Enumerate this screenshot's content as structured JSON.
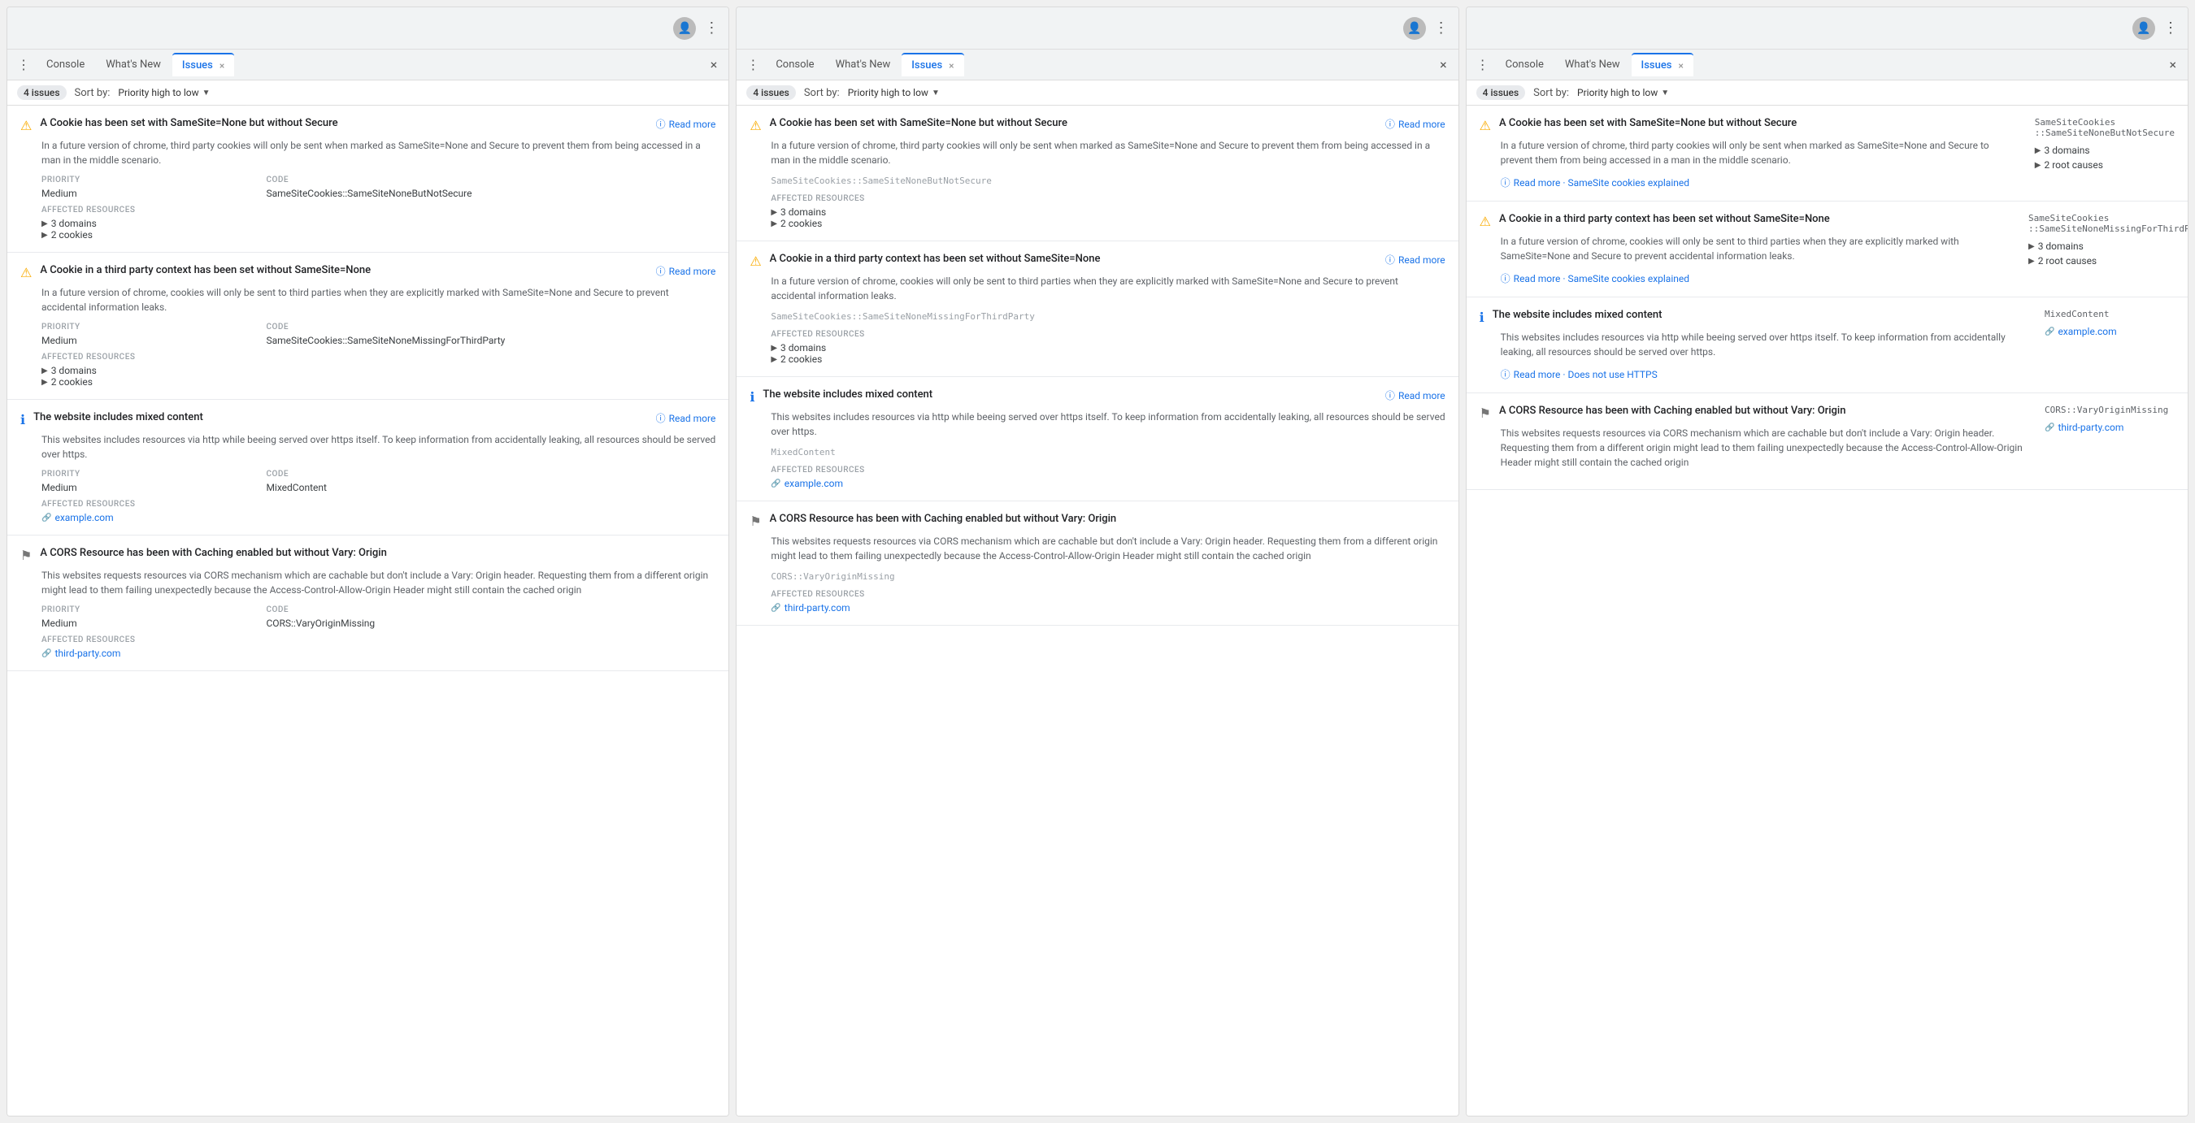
{
  "colors": {
    "accent": "#1a73e8",
    "warning": "#f9ab00",
    "info": "#1a73e8",
    "text_primary": "#202124",
    "text_secondary": "#5f6368",
    "text_muted": "#9aa0a6",
    "border": "#e8eaed"
  },
  "panels": [
    {
      "id": "panel1",
      "tabs": [
        {
          "label": "Console",
          "active": false,
          "closeable": false
        },
        {
          "label": "What's New",
          "active": false,
          "closeable": false
        },
        {
          "label": "Issues",
          "active": true,
          "closeable": true
        }
      ],
      "toolbar": {
        "issues_count": "4 issues",
        "sort_label": "Sort by:",
        "sort_value": "Priority high to low"
      },
      "issues": [
        {
          "type": "warning",
          "title": "A Cookie has been set with SameSite=None but without Secure",
          "read_more": "Read more",
          "description": "In a future version of chrome, third party cookies will only be sent when marked as SameSite=None and Secure to prevent them from being accessed in a man in the middle scenario.",
          "priority_label": "PRIORITY",
          "priority_value": "Medium",
          "code_label": "CODE",
          "code_value": "SameSiteCookies::SameSiteNoneButNotSecure",
          "affected_label": "AFFECTED RESOURCES",
          "resources": [
            {
              "type": "expand",
              "label": "3 domains"
            },
            {
              "type": "expand",
              "label": "2 cookies"
            }
          ]
        },
        {
          "type": "warning",
          "title": "A Cookie in a third party context has been set without SameSite=None",
          "read_more": "Read more",
          "description": "In a future version of chrome, cookies will only be sent to third parties when they are explicitly marked with SameSite=None and Secure to prevent accidental information leaks.",
          "priority_label": "PRIORITY",
          "priority_value": "Medium",
          "code_label": "CODE",
          "code_value": "SameSiteCookies::SameSiteNoneMissingForThirdParty",
          "affected_label": "AFFECTED RESOURCES",
          "resources": [
            {
              "type": "expand",
              "label": "3 domains"
            },
            {
              "type": "expand",
              "label": "2 cookies"
            }
          ]
        },
        {
          "type": "info",
          "title": "The website includes mixed content",
          "read_more": "Read more",
          "description": "This websites includes resources via http while beeing served over https itself. To keep information from accidentally leaking, all resources should be served over https.",
          "priority_label": "PRIORITY",
          "priority_value": "Medium",
          "code_label": "CODE",
          "code_value": "MixedContent",
          "affected_label": "AFFECTED RESOURCES",
          "resources": [
            {
              "type": "link",
              "label": "example.com"
            }
          ]
        },
        {
          "type": "flag",
          "title": "A CORS Resource has been with Caching enabled but without Vary: Origin",
          "read_more": null,
          "description": "This websites requests resources via CORS mechanism which are cachable but don't include a Vary: Origin header. Requesting them from a different origin might lead to them failing unexpectedly because the Access-Control-Allow-Origin Header might still contain the cached origin",
          "priority_label": "PRIORITY",
          "priority_value": "Medium",
          "code_label": "CODE",
          "code_value": "CORS::VaryOriginMissing",
          "affected_label": "AFFECTED RESOURCES",
          "resources": [
            {
              "type": "link",
              "label": "third-party.com"
            }
          ]
        }
      ]
    },
    {
      "id": "panel2",
      "tabs": [
        {
          "label": "Console",
          "active": false,
          "closeable": false
        },
        {
          "label": "What's New",
          "active": false,
          "closeable": false
        },
        {
          "label": "Issues",
          "active": true,
          "closeable": true
        }
      ],
      "toolbar": {
        "issues_count": "4 issues",
        "sort_label": "Sort by:",
        "sort_value": "Priority high to low"
      },
      "issues": [
        {
          "type": "warning",
          "title": "A Cookie has been set with SameSite=None but without Secure",
          "read_more": "Read more",
          "description": "In a future version of chrome, third party cookies will only be sent when marked as SameSite=None and Secure to prevent them from being accessed in a man in the middle scenario.",
          "code_small": "SameSiteCookies::SameSiteNoneButNotSecure",
          "affected_label": "AFFECTED RESOURCES",
          "resources": [
            {
              "type": "expand",
              "label": "3 domains"
            },
            {
              "type": "expand",
              "label": "2 cookies"
            }
          ]
        },
        {
          "type": "warning",
          "title": "A Cookie in a third party context has been set without SameSite=None",
          "read_more": "Read more",
          "description": "In a future version of chrome, cookies will only be sent to third parties when they are explicitly marked with SameSite=None and Secure to prevent accidental information leaks.",
          "code_small": "SameSiteCookies::SameSiteNoneMissingForThirdParty",
          "affected_label": "AFFECTED RESOURCES",
          "resources": [
            {
              "type": "expand",
              "label": "3 domains"
            },
            {
              "type": "expand",
              "label": "2 cookies"
            }
          ]
        },
        {
          "type": "info",
          "title": "The website includes mixed content",
          "read_more": "Read more",
          "description": "This websites includes resources via http while beeing served over https itself. To keep information from accidentally leaking, all resources should be served over https.",
          "code_small": "MixedContent",
          "affected_label": "AFFECTED RESOURCES",
          "resources": [
            {
              "type": "link",
              "label": "example.com"
            }
          ]
        },
        {
          "type": "flag",
          "title": "A CORS Resource has been with Caching enabled but without Vary: Origin",
          "read_more": null,
          "description": "This websites requests resources via CORS mechanism which are cachable but don't include a Vary: Origin header. Requesting them from a different origin might lead to them failing unexpectedly because the Access-Control-Allow-Origin Header might still contain the cached origin",
          "code_small": "CORS::VaryOriginMissing",
          "affected_label": "AFFECTED RESOURCES",
          "resources": [
            {
              "type": "link",
              "label": "third-party.com"
            }
          ]
        }
      ]
    },
    {
      "id": "panel3",
      "tabs": [
        {
          "label": "Console",
          "active": false,
          "closeable": false
        },
        {
          "label": "What's New",
          "active": false,
          "closeable": false
        },
        {
          "label": "Issues",
          "active": true,
          "closeable": true
        }
      ],
      "toolbar": {
        "issues_count": "4 issues",
        "sort_label": "Sort by:",
        "sort_value": "Priority high to low"
      },
      "issues": [
        {
          "type": "warning",
          "title": "A Cookie has been set with SameSite=None but without Secure",
          "description": "In a future version of chrome, third party cookies will only be sent when marked as SameSite=None and Secure to prevent them from being accessed in a man in the middle scenario.",
          "read_more_link": "Read more · SameSite cookies explained",
          "right_code": "SameSiteCookies\n::SameSiteNoneButNotSecure",
          "right_stats": [
            "3 domains",
            "2 root causes"
          ]
        },
        {
          "type": "warning",
          "title": "A Cookie in a third party context has been set without SameSite=None",
          "description": "In a future version of chrome, cookies will only be sent to third parties when they are explicitly marked with SameSite=None and Secure to prevent accidental information leaks.",
          "read_more_link": "Read more · SameSite cookies explained",
          "right_code": "SameSiteCookies\n::SameSiteNoneMissingForThirdParty",
          "right_stats": [
            "3 domains",
            "2 root causes"
          ]
        },
        {
          "type": "info",
          "title": "The website includes mixed content",
          "description": "This websites includes resources via http while beeing served over https itself. To keep information from accidentally leaking, all resources should be served over https.",
          "read_more_link": "Read more · Does not use HTTPS",
          "right_code": "MixedContent",
          "right_link": "example.com"
        },
        {
          "type": "flag",
          "title": "A CORS Resource has been with Caching enabled but without Vary: Origin",
          "description": "This websites requests resources via CORS mechanism which are cachable but don't include a Vary: Origin header. Requesting them from a different origin might lead to them failing unexpectedly because the Access-Control-Allow-Origin Header might still contain the cached origin",
          "read_more_link": null,
          "right_code": "CORS::VaryOriginMissing",
          "right_link": "third-party.com"
        }
      ]
    }
  ],
  "labels": {
    "console": "Console",
    "whats_new": "What's New",
    "issues": "Issues",
    "sort_by": "Sort by:",
    "priority_high_low": "Priority high to low",
    "priority": "PRIORITY",
    "medium": "Medium",
    "code": "CODE",
    "affected_resources": "AFFECTED RESOURCES",
    "read_more": "Read more",
    "close": "×"
  }
}
